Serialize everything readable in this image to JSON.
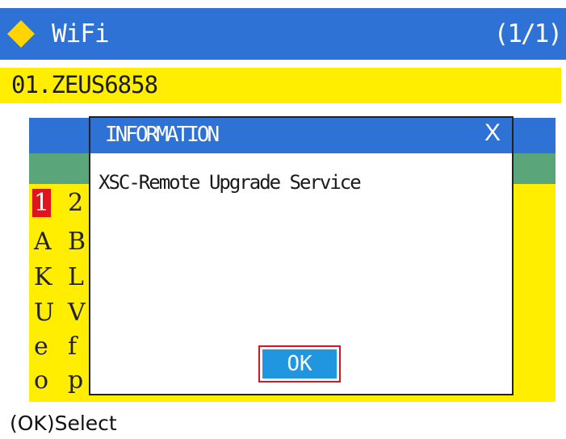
{
  "header": {
    "title": "WiFi",
    "pager": "(1/1)"
  },
  "networks": [
    {
      "label": "01.ZEUS6858"
    }
  ],
  "keyboard": {
    "rows": [
      [
        "1",
        "2"
      ],
      [
        "A",
        "B"
      ],
      [
        "K",
        "L"
      ],
      [
        "U",
        "V"
      ],
      [
        "e",
        "f"
      ],
      [
        "o",
        "p"
      ]
    ]
  },
  "dialog": {
    "title": "INFORMATION",
    "close_label": "X",
    "message": "XSC-Remote Upgrade Service",
    "ok_label": "OK"
  },
  "footer": {
    "hint": "(OK)Select"
  },
  "colors": {
    "header_blue": "#2f72d6",
    "highlight_yellow": "#ffee00",
    "selection_red": "#e0141e",
    "ok_blue": "#2196e0"
  },
  "icons": {
    "title_icon": "diamond-icon"
  }
}
